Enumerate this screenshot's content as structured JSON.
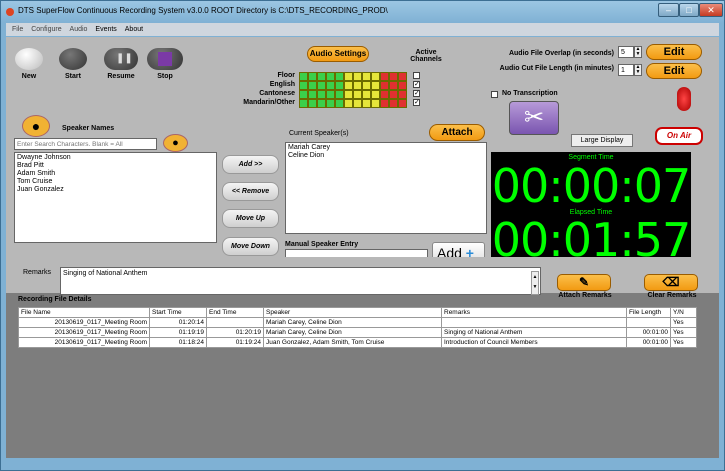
{
  "window": {
    "title": "DTS SuperFlow Continuous Recording System v3.0.0  ROOT Directory is C:\\DTS_RECORDING_PROD\\"
  },
  "menu": [
    "File",
    "Configure",
    "Audio",
    "Events",
    "About"
  ],
  "toolbar": {
    "new": "New",
    "start": "Start",
    "resume": "Resume",
    "stop": "Stop"
  },
  "audio": {
    "settings_label": "Audio Settings",
    "active_channels_label": "Active\nChannels",
    "channels": [
      {
        "name": "Floor",
        "checked": false
      },
      {
        "name": "English",
        "checked": true
      },
      {
        "name": "Cantonese",
        "checked": true
      },
      {
        "name": "Mandarin/Other",
        "checked": true
      }
    ],
    "meter_colors": [
      "#3bd04a",
      "#3bd04a",
      "#3bd04a",
      "#3bd04a",
      "#3bd04a",
      "#e5e53a",
      "#e5e53a",
      "#e5e53a",
      "#e5e53a",
      "#e03030",
      "#e03030",
      "#e03030"
    ]
  },
  "file_settings": {
    "overlap_label": "Audio File Overlap (in seconds)",
    "overlap_value": "5",
    "cut_label": "Audio Cut File Length (in minutes)",
    "cut_value": "1",
    "edit_label": "Edit"
  },
  "transcription": {
    "label": "No Transcription",
    "checked": false
  },
  "speakers": {
    "names_label": "Speaker Names",
    "search_placeholder": "Enter Search Characters. Blank = All",
    "list": [
      "Dwayne Johnson",
      "Brad Pitt",
      "Adam Smith",
      "Tom Cruise",
      "Juan Gonzalez"
    ],
    "current_label": "Current Speaker(s)",
    "current": [
      "Mariah Carey",
      "Celine Dion"
    ],
    "manual_label": "Manual Speaker Entry",
    "add_label": "Add"
  },
  "actions": {
    "add": "Add >>",
    "remove": "<< Remove",
    "move_up": "Move Up",
    "move_down": "Move Down",
    "attach": "Attach",
    "large_display": "Large Display",
    "on_air": "On Air"
  },
  "timer": {
    "segment_label": "Segment Time",
    "segment": "00:00:07",
    "elapsed_label": "Elapsed Time",
    "elapsed": "00:01:57"
  },
  "remarks": {
    "label": "Remarks",
    "value": "Singing of National Anthem",
    "attach_label": "Attach Remarks",
    "clear_label": "Clear Remarks"
  },
  "details": {
    "label": "Recording File Details",
    "columns": [
      "File Name",
      "Start Time",
      "End Time",
      "Speaker",
      "Remarks",
      "File Length",
      "Y/N"
    ],
    "rows": [
      [
        "20130619_0117_Meeting Room",
        "01:20:14",
        "",
        "Mariah Carey, Celine Dion",
        "",
        "",
        "Yes"
      ],
      [
        "20130619_0117_Meeting Room",
        "01:19:19",
        "01:20:19",
        "Mariah Carey, Celine Dion",
        "Singing of National Anthem",
        "00:01:00",
        "Yes"
      ],
      [
        "20130619_0117_Meeting Room",
        "01:18:24",
        "01:19:24",
        "Juan Gonzalez, Adam Smith, Tom Cruise",
        "Introduction of Council Members",
        "00:01:00",
        "Yes"
      ]
    ]
  }
}
